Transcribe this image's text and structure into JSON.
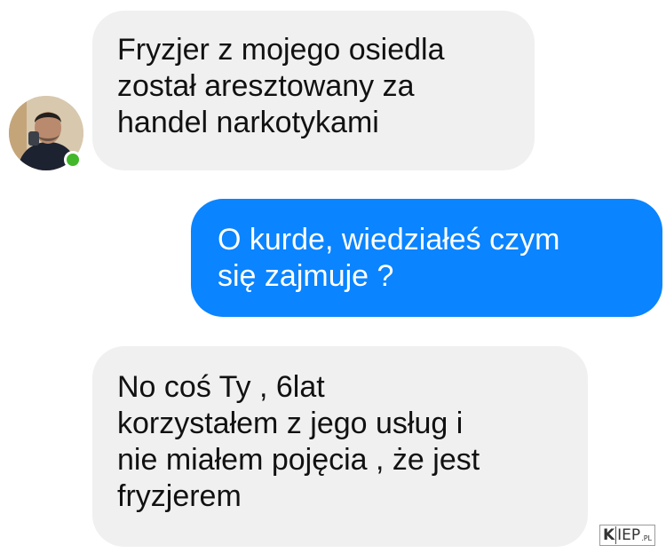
{
  "conversation": {
    "messages": [
      {
        "direction": "incoming",
        "lines": [
          "Fryzjer z mojego osiedla",
          "został aresztowany za",
          "handel narkotykami"
        ]
      },
      {
        "direction": "outgoing",
        "lines": [
          "O kurde, wiedziałeś czym",
          "się zajmuje ?"
        ]
      },
      {
        "direction": "incoming",
        "lines": [
          "No coś Ty , 6lat",
          "korzystałem z jego usług i",
          "nie miałem pojęcia , że jest",
          "fryzjerem"
        ]
      }
    ]
  },
  "contact": {
    "avatar_icon": "person-avatar-icon",
    "online": true
  },
  "colors": {
    "incoming_bubble": "#f0f0f0",
    "outgoing_bubble": "#0a84ff",
    "online_indicator": "#42b72a"
  },
  "watermark": {
    "brand": "KIEP",
    "k": "K",
    "iep": "IEP",
    "tld": ".PL"
  }
}
